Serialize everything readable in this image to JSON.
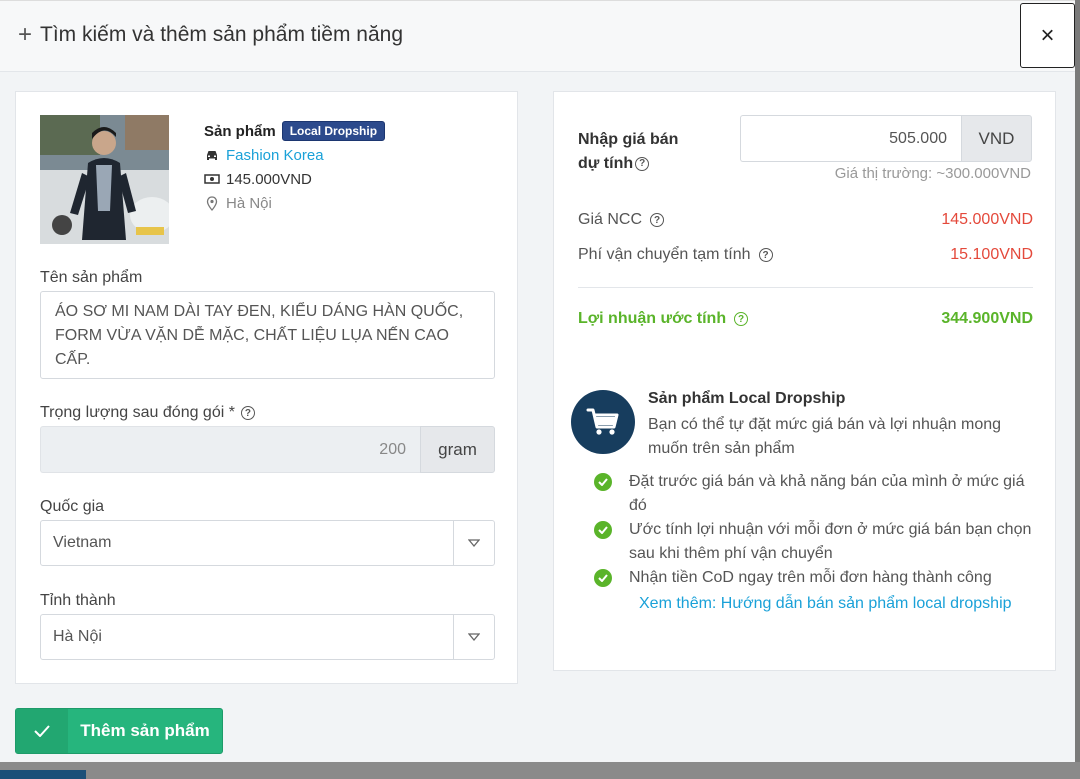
{
  "modal": {
    "title": "Tìm kiếm và thêm sản phẩm tiềm năng",
    "close_label": "×"
  },
  "product": {
    "label": "Sản phẩm",
    "tag": "Local Dropship",
    "supplier": "Fashion Korea",
    "price": "145.000VND",
    "location": "Hà Nội"
  },
  "form": {
    "name_label": "Tên sản phẩm",
    "name_value": "ÁO SƠ MI NAM DÀI TAY ĐEN, KIỂU DÁNG HÀN QUỐC, FORM VỪA VẶN DỄ MẶC, CHẤT LIỆU LỤA NẾN CAO CẤP.",
    "weight_label": "Trọng lượng sau đóng gói *",
    "weight_value": "200",
    "weight_unit": "gram",
    "country_label": "Quốc gia",
    "country_value": "Vietnam",
    "province_label": "Tỉnh thành",
    "province_value": "Hà Nội"
  },
  "pricing": {
    "sell_label_line1": "Nhập giá bán",
    "sell_label_line2": "dự tính",
    "sell_value": "505.000",
    "sell_unit": "VND",
    "market_price": "Giá thị trường: ~300.000VND",
    "ncc_label": "Giá NCC",
    "ncc_value": "145.000VND",
    "shipping_label": "Phí vận chuyển tạm tính",
    "shipping_value": "15.100VND",
    "profit_label": "Lợi nhuận ước tính",
    "profit_value": "344.900VND"
  },
  "promo": {
    "title": "Sản phẩm Local Dropship",
    "text": "Bạn có thể tự đặt mức giá bán và lợi nhuận mong muốn trên sản phẩm",
    "items": [
      "Đặt trước giá bán và khả năng bán của mình ở mức giá đó",
      "Ước tính lợi nhuận với mỗi đơn ở mức giá bán bạn chọn sau khi thêm phí vận chuyển",
      "Nhận tiền CoD ngay trên mỗi đơn hàng thành công"
    ],
    "more_link": "Xem thêm: Hướng dẫn bán sản phẩm local dropship"
  },
  "actions": {
    "add_label": "Thêm sản phẩm"
  },
  "colors": {
    "accent_green": "#26b57d",
    "profit_green": "#5ab42a",
    "cost_red": "#e4493b",
    "link_blue": "#1aa1d8",
    "tag_navy": "#2c4a8c"
  },
  "icons": [
    "plus-icon",
    "close-icon",
    "car-icon",
    "money-icon",
    "map-pin-icon",
    "help-icon",
    "chevron-down-icon",
    "cart-icon",
    "check-icon"
  ]
}
